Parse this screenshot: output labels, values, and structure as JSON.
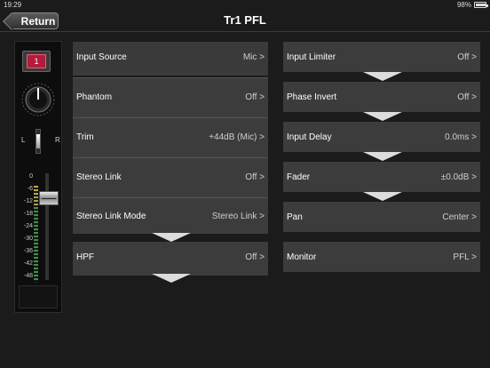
{
  "status": {
    "time": "19:29",
    "battery": "98%",
    "battery_level": 0.98
  },
  "nav": {
    "back_label": "Return",
    "title": "Tr1 PFL"
  },
  "strip": {
    "channel_number": "1",
    "pan_left": "L",
    "pan_right": "R",
    "scale": [
      "0",
      "-6",
      "-12",
      "-18",
      "-24",
      "-30",
      "-36",
      "-42",
      "-48"
    ]
  },
  "left_params": [
    {
      "label": "Input Source",
      "value": "Mic >"
    },
    {
      "label": "Phantom",
      "value": "Off >"
    },
    {
      "label": "Trim",
      "value": "+44dB (Mic) >"
    },
    {
      "label": "Stereo Link",
      "value": "Off >"
    },
    {
      "label": "Stereo Link Mode",
      "value": "Stereo Link >"
    },
    {
      "label": "HPF",
      "value": "Off >"
    }
  ],
  "right_params": [
    {
      "label": "Input Limiter",
      "value": "Off >"
    },
    {
      "label": "Phase Invert",
      "value": "Off >"
    },
    {
      "label": "Input Delay",
      "value": "0.0ms >"
    },
    {
      "label": "Fader",
      "value": "±0.0dB >"
    },
    {
      "label": "Pan",
      "value": "Center >"
    },
    {
      "label": "Monitor",
      "value": "PFL >"
    }
  ],
  "colors": {
    "row_bg": "#3c3c3c",
    "channel_red": "#b21c3c",
    "arrow": "#dcdcdc"
  }
}
